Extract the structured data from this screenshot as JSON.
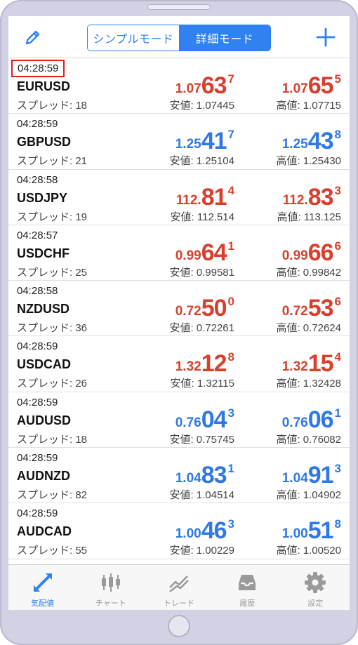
{
  "header": {
    "edit_icon": "pencil-icon",
    "add_icon": "plus-icon",
    "segments": [
      {
        "label": "シンプルモード",
        "active": false
      },
      {
        "label": "詳細モード",
        "active": true
      }
    ]
  },
  "quotes": [
    {
      "time": "04:28:59",
      "symbol": "EURUSD",
      "spread": "スプレッド: 18",
      "direction": "down",
      "bid": {
        "small": "1.07",
        "big": "63",
        "sup": "7"
      },
      "ask": {
        "small": "1.07",
        "big": "65",
        "sup": "5"
      },
      "low": "安値: 1.07445",
      "high": "高値: 1.07715"
    },
    {
      "time": "04:28:59",
      "symbol": "GBPUSD",
      "spread": "スプレッド: 21",
      "direction": "up",
      "bid": {
        "small": "1.25",
        "big": "41",
        "sup": "7"
      },
      "ask": {
        "small": "1.25",
        "big": "43",
        "sup": "8"
      },
      "low": "安値: 1.25104",
      "high": "高値: 1.25430"
    },
    {
      "time": "04:28:58",
      "symbol": "USDJPY",
      "spread": "スプレッド: 19",
      "direction": "down",
      "bid": {
        "small": "112.",
        "big": "81",
        "sup": "4"
      },
      "ask": {
        "small": "112.",
        "big": "83",
        "sup": "3"
      },
      "low": "安値: 112.514",
      "high": "高値: 113.125"
    },
    {
      "time": "04:28:57",
      "symbol": "USDCHF",
      "spread": "スプレッド: 25",
      "direction": "down",
      "bid": {
        "small": "0.99",
        "big": "64",
        "sup": "1"
      },
      "ask": {
        "small": "0.99",
        "big": "66",
        "sup": "6"
      },
      "low": "安値: 0.99581",
      "high": "高値: 0.99842"
    },
    {
      "time": "04:28:58",
      "symbol": "NZDUSD",
      "spread": "スプレッド: 36",
      "direction": "down",
      "bid": {
        "small": "0.72",
        "big": "50",
        "sup": "0"
      },
      "ask": {
        "small": "0.72",
        "big": "53",
        "sup": "6"
      },
      "low": "安値: 0.72261",
      "high": "高値: 0.72624"
    },
    {
      "time": "04:28:59",
      "symbol": "USDCAD",
      "spread": "スプレッド: 26",
      "direction": "down",
      "bid": {
        "small": "1.32",
        "big": "12",
        "sup": "8"
      },
      "ask": {
        "small": "1.32",
        "big": "15",
        "sup": "4"
      },
      "low": "安値: 1.32115",
      "high": "高値: 1.32428"
    },
    {
      "time": "04:28:59",
      "symbol": "AUDUSD",
      "spread": "スプレッド: 18",
      "direction": "up",
      "bid": {
        "small": "0.76",
        "big": "04",
        "sup": "3"
      },
      "ask": {
        "small": "0.76",
        "big": "06",
        "sup": "1"
      },
      "low": "安値: 0.75745",
      "high": "高値: 0.76082"
    },
    {
      "time": "04:28:59",
      "symbol": "AUDNZD",
      "spread": "スプレッド: 82",
      "direction": "up",
      "bid": {
        "small": "1.04",
        "big": "83",
        "sup": "1"
      },
      "ask": {
        "small": "1.04",
        "big": "91",
        "sup": "3"
      },
      "low": "安値: 1.04514",
      "high": "高値: 1.04902"
    },
    {
      "time": "04:28:59",
      "symbol": "AUDCAD",
      "spread": "スプレッド: 55",
      "direction": "up",
      "bid": {
        "small": "1.00",
        "big": "46",
        "sup": "3"
      },
      "ask": {
        "small": "1.00",
        "big": "51",
        "sup": "8"
      },
      "low": "安値: 1.00229",
      "high": "高値: 1.00520"
    }
  ],
  "tabbar": {
    "items": [
      {
        "label": "気配値",
        "icon": "quotes-arrows-icon",
        "active": true
      },
      {
        "label": "チャート",
        "icon": "candlestick-chart-icon",
        "active": false
      },
      {
        "label": "トレード",
        "icon": "trade-trend-icon",
        "active": false
      },
      {
        "label": "履歴",
        "icon": "history-inbox-icon",
        "active": false
      },
      {
        "label": "設定",
        "icon": "gear-icon",
        "active": false
      }
    ]
  },
  "colors": {
    "accent": "#2f82f0",
    "price_up": "#2f78e6",
    "price_down": "#d8402e",
    "highlight_box": "#e01e1e",
    "tab_inactive": "#9a9a9a"
  }
}
